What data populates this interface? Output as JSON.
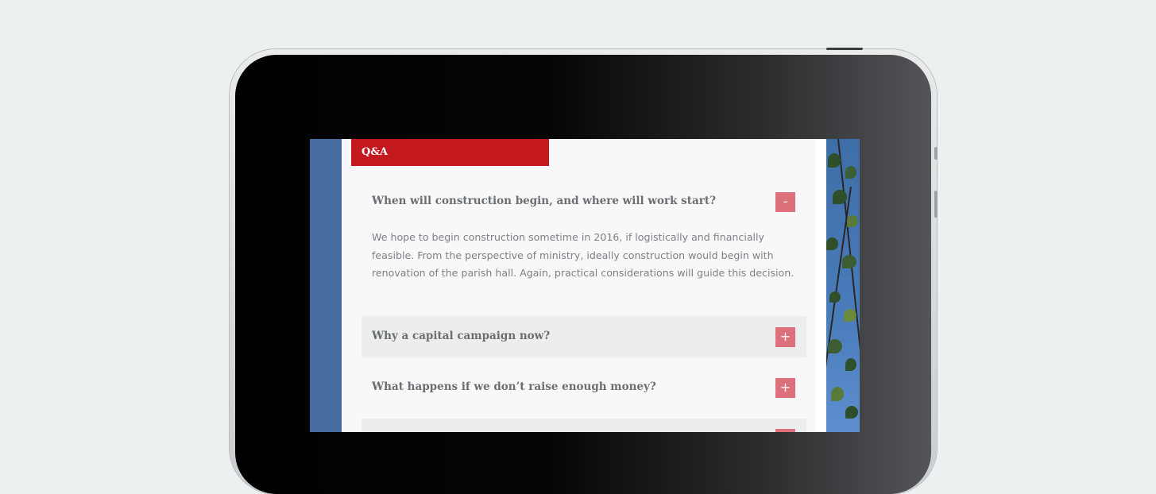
{
  "section": {
    "tab_label": "Q&A"
  },
  "faq": [
    {
      "question": "When will construction begin, and where will work start?",
      "toggle": "-",
      "answer": "We hope to begin construction sometime in 2016, if logistically and financially feasible. From the perspective of ministry, ideally construction would begin with renovation of the parish hall. Again, practical considerations will guide this decision."
    },
    {
      "question": "Why a capital campaign now?",
      "toggle": "+"
    },
    {
      "question": "What happens if we don’t raise enough money?",
      "toggle": "+"
    },
    {
      "question": "",
      "toggle": "+"
    }
  ],
  "colors": {
    "accent": "#c41a1f",
    "toggle": "#dc707b",
    "question_text": "#6b6f72",
    "answer_text": "#7d8185",
    "alt_row": "#ebedee"
  }
}
